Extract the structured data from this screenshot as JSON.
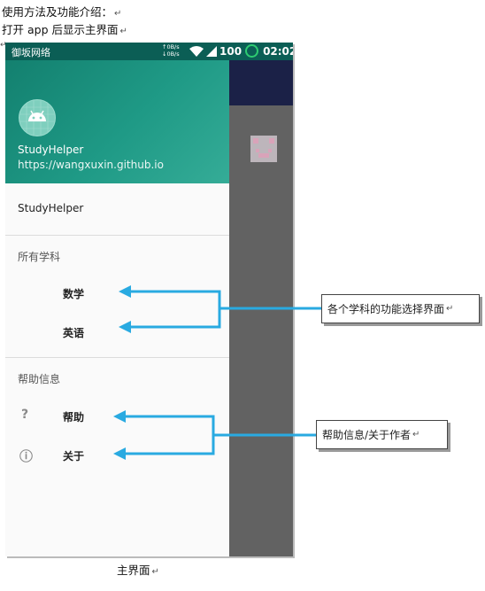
{
  "doc": {
    "line1": "使用方法及功能介绍：",
    "line2": "打开 app 后显示主界面",
    "return_mark": "↵",
    "left_mark": "↵",
    "caption": "主界面"
  },
  "statusbar": {
    "carrier": "御坂网络",
    "speed_up": "↑0B/s",
    "speed_down": "↓0B/s",
    "battery": "100",
    "time": "02:02"
  },
  "drawer": {
    "header_title": "StudyHelper",
    "header_subtitle": "https://wangxuxin.github.io",
    "top_item": "StudyHelper",
    "section1_title": "所有学科",
    "section1_items": [
      "数学",
      "英语"
    ],
    "section2_title": "帮助信息",
    "section2_items": [
      {
        "label": "帮助",
        "icon": "question-icon",
        "glyph": "?"
      },
      {
        "label": "关于",
        "icon": "info-icon",
        "glyph": "ⓘ"
      }
    ]
  },
  "callouts": {
    "subjects": "各个学科的功能选择界面",
    "help": "帮助信息/关于作者"
  },
  "colors": {
    "header_teal": "#13806f",
    "toolbar_navy": "#1b2147",
    "arrow_blue": "#29aae1",
    "scrim_gray": "#626262"
  }
}
